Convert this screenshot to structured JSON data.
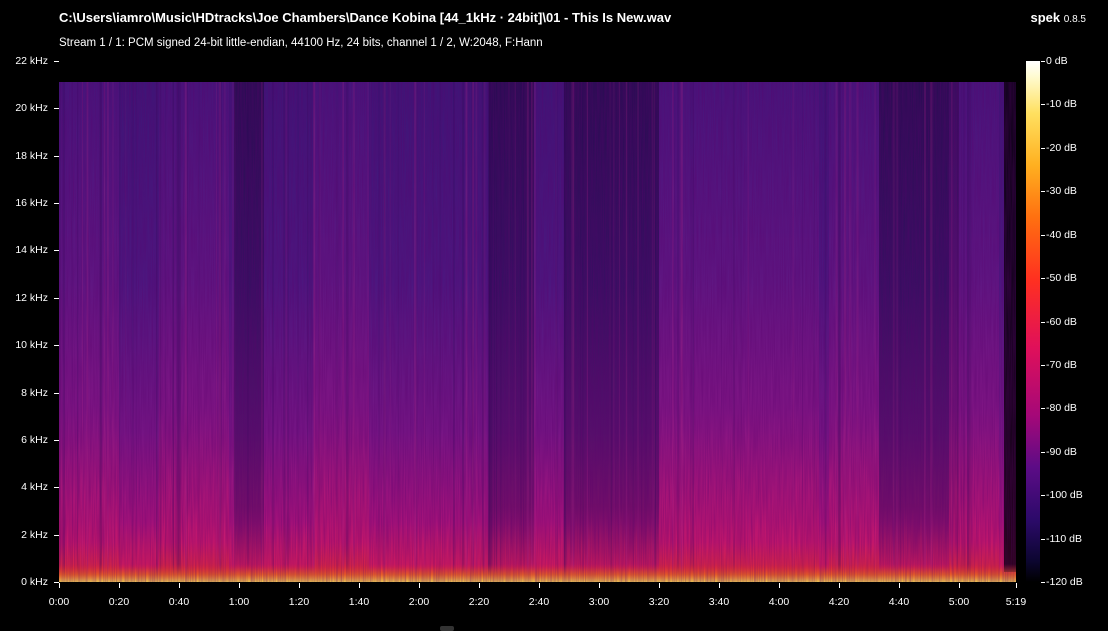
{
  "window": {
    "file_path": "C:\\Users\\iamro\\Music\\HDtracks\\Joe Chambers\\Dance Kobina [44_1kHz · 24bit]\\01 - This Is New.wav",
    "stream_info": "Stream 1 / 1: PCM signed 24-bit little-endian, 44100 Hz, 24 bits, channel 1 / 2, W:2048, F:Hann",
    "app_name": "spek",
    "app_version": "0.8.5"
  },
  "freq_axis": {
    "labels": [
      "22 kHz",
      "20 kHz",
      "18 kHz",
      "16 kHz",
      "14 kHz",
      "12 kHz",
      "10 kHz",
      "8 kHz",
      "6 kHz",
      "4 kHz",
      "2 kHz",
      "0 kHz"
    ],
    "values_khz": [
      22,
      20,
      18,
      16,
      14,
      12,
      10,
      8,
      6,
      4,
      2,
      0
    ],
    "max_khz": 22
  },
  "time_axis": {
    "labels": [
      "0:00",
      "0:20",
      "0:40",
      "1:00",
      "1:20",
      "1:40",
      "2:00",
      "2:20",
      "2:40",
      "3:00",
      "3:20",
      "3:40",
      "4:00",
      "4:20",
      "4:40",
      "5:00",
      "5:19"
    ],
    "values_s": [
      0,
      20,
      40,
      60,
      80,
      100,
      120,
      140,
      160,
      180,
      200,
      220,
      240,
      260,
      280,
      300,
      319
    ],
    "duration_s": 319
  },
  "db_scale": {
    "labels": [
      "0 dB",
      "-10 dB",
      "-20 dB",
      "-30 dB",
      "-40 dB",
      "-50 dB",
      "-60 dB",
      "-70 dB",
      "-80 dB",
      "-90 dB",
      "-100 dB",
      "-110 dB",
      "-120 dB"
    ],
    "values_db": [
      0,
      -10,
      -20,
      -30,
      -40,
      -50,
      -60,
      -70,
      -80,
      -90,
      -100,
      -110,
      -120
    ],
    "min_db": -120
  },
  "colors": {
    "background": "#000000",
    "text": "#ffffff",
    "spectrum_low": "#2a0c5e",
    "spectrum_mid": "#b0187a",
    "spectrum_high": "#ff3a20",
    "spectrum_peak": "#ffd040"
  }
}
